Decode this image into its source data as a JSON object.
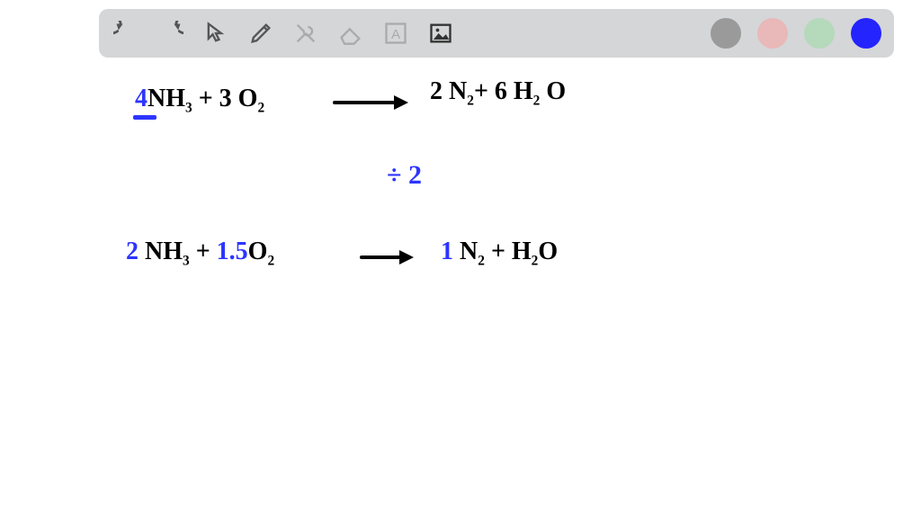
{
  "toolbar": {
    "tools": [
      {
        "name": "undo-icon"
      },
      {
        "name": "redo-icon"
      },
      {
        "name": "cursor-icon"
      },
      {
        "name": "pencil-icon"
      },
      {
        "name": "tools-icon"
      },
      {
        "name": "eraser-icon"
      },
      {
        "name": "text-icon"
      },
      {
        "name": "image-icon"
      }
    ],
    "colors": [
      {
        "name": "color-gray",
        "hex": "#9a9a9a"
      },
      {
        "name": "color-pink",
        "hex": "#e9b8b8"
      },
      {
        "name": "color-green",
        "hex": "#b5d9bb"
      },
      {
        "name": "color-blue",
        "hex": "#2424ff"
      }
    ]
  },
  "equations": {
    "line1": {
      "c1": "4",
      "r1": "NH",
      "s1": "3",
      "plus1": " + 3 O",
      "s2": "2",
      "after_arrow_a": " 2 N",
      "s3": "2",
      "plus2": "+  6 H",
      "s4": "2",
      "tail": " O"
    },
    "divide": "÷ 2",
    "line2": {
      "c1": "2",
      "r1": " NH",
      "s1": "3",
      "plus1": " + ",
      "c2": "1.5",
      "r2": "O",
      "s2": "2",
      "after_arrow_a": "1",
      "after_arrow_b": " N",
      "s3": "2",
      "plus2": " +   H",
      "s4": "2",
      "tail": "O"
    }
  }
}
